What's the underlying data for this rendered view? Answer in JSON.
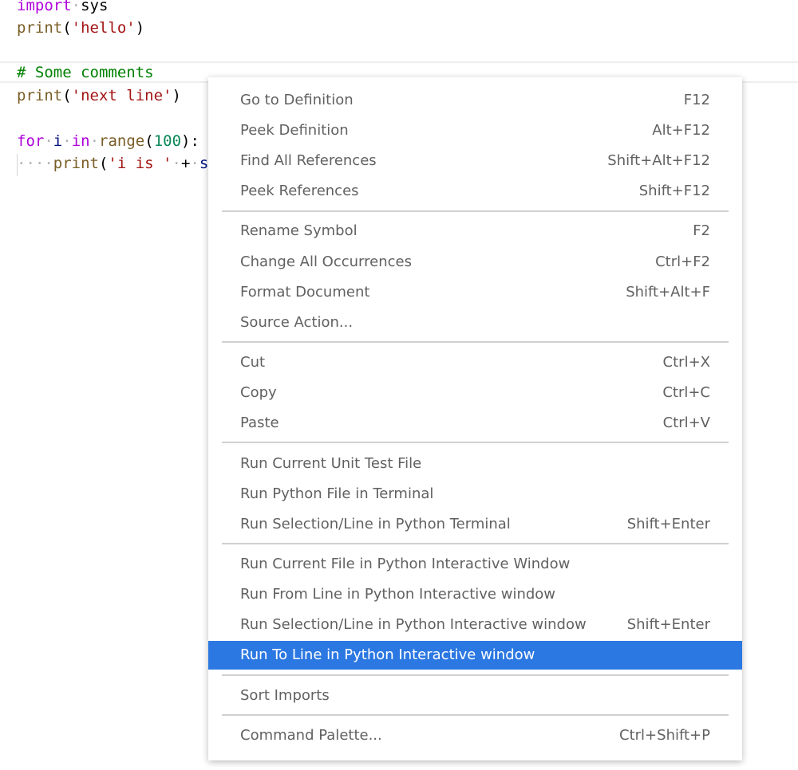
{
  "editor": {
    "lines": {
      "l1": {
        "import_kw": "import",
        "module": "sys"
      },
      "l2": {
        "fn": "print",
        "open": "(",
        "str": "'hello'",
        "close": ")"
      },
      "l3": {
        "comment": "# Some comments"
      },
      "l4": {
        "fn": "print",
        "open": "(",
        "str": "'next line'",
        "close": ")"
      },
      "l5": {
        "for_kw": "for",
        "var": "i",
        "in_kw": "in",
        "range_fn": "range",
        "open": "(",
        "num": "100",
        "close": "):"
      },
      "l6": {
        "fn": "print",
        "open": "(",
        "str": "'i is '",
        "plus": "+",
        "tail": "s"
      }
    }
  },
  "context_menu": {
    "items": [
      {
        "label": "Go to Definition",
        "key": "F12"
      },
      {
        "label": "Peek Definition",
        "key": "Alt+F12"
      },
      {
        "label": "Find All References",
        "key": "Shift+Alt+F12"
      },
      {
        "label": "Peek References",
        "key": "Shift+F12"
      },
      {
        "label": "Rename Symbol",
        "key": "F2"
      },
      {
        "label": "Change All Occurrences",
        "key": "Ctrl+F2"
      },
      {
        "label": "Format Document",
        "key": "Shift+Alt+F"
      },
      {
        "label": "Source Action...",
        "key": ""
      },
      {
        "label": "Cut",
        "key": "Ctrl+X"
      },
      {
        "label": "Copy",
        "key": "Ctrl+C"
      },
      {
        "label": "Paste",
        "key": "Ctrl+V"
      },
      {
        "label": "Run Current Unit Test File",
        "key": ""
      },
      {
        "label": "Run Python File in Terminal",
        "key": ""
      },
      {
        "label": "Run Selection/Line in Python Terminal",
        "key": "Shift+Enter"
      },
      {
        "label": "Run Current File in Python Interactive Window",
        "key": ""
      },
      {
        "label": "Run From Line in Python Interactive window",
        "key": ""
      },
      {
        "label": "Run Selection/Line in Python Interactive window",
        "key": "Shift+Enter"
      },
      {
        "label": "Run To Line in Python Interactive window",
        "key": "",
        "selected": true
      },
      {
        "label": "Sort Imports",
        "key": ""
      },
      {
        "label": "Command Palette...",
        "key": "Ctrl+Shift+P"
      }
    ]
  },
  "colors": {
    "selection": "#2c78e2",
    "menu_text": "#616161",
    "keyword_blue": "#0000ff",
    "string_red": "#a31515",
    "comment_green": "#008000"
  }
}
